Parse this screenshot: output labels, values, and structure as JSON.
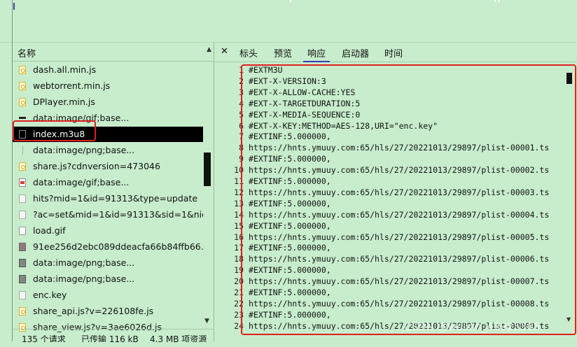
{
  "network": {
    "column_header": "名称",
    "files": [
      {
        "name": "dash.all.min.js",
        "icon": "js"
      },
      {
        "name": "webtorrent.min.js",
        "icon": "js"
      },
      {
        "name": "DPlayer.min.js",
        "icon": "js"
      },
      {
        "name": "data:image/gif;base...",
        "icon": "bar"
      },
      {
        "name": "index.m3u8",
        "icon": "plain",
        "selected": true
      },
      {
        "name": "data:image/png;base...",
        "icon": "thin"
      },
      {
        "name": "share.js?cdnversion=473046",
        "icon": "js"
      },
      {
        "name": "data:image/gif;base...",
        "icon": "gif-red"
      },
      {
        "name": "hits?mid=1&id=91313&type=update",
        "icon": "doc"
      },
      {
        "name": "?ac=set&mid=1&id=91313&sid=1&nid=",
        "icon": "doc"
      },
      {
        "name": "load.gif",
        "icon": "plain"
      },
      {
        "name": "91ee256d2ebc089ddeacfa66b84ffb66.jpg",
        "icon": "img"
      },
      {
        "name": "data:image/png;base...",
        "icon": "img-dark"
      },
      {
        "name": "data:image/png;base...",
        "icon": "img-dark"
      },
      {
        "name": "enc.key",
        "icon": "doc"
      },
      {
        "name": "share_api.js?v=226108fe.js",
        "icon": "js"
      },
      {
        "name": "share_view.js?v=3ae6026d.js",
        "icon": "js"
      }
    ],
    "status": {
      "requests": "135 个请求",
      "transferred": "已传输 116 kB",
      "resources": "4.3 MB 项资源"
    }
  },
  "detail": {
    "tabs": [
      "标头",
      "预览",
      "响应",
      "启动器",
      "时间"
    ],
    "active_tab": "响应",
    "lines": [
      "#EXTM3U",
      "#EXT-X-VERSION:3",
      "#EXT-X-ALLOW-CACHE:YES",
      "#EXT-X-TARGETDURATION:5",
      "#EXT-X-MEDIA-SEQUENCE:0",
      "#EXT-X-KEY:METHOD=AES-128,URI=\"enc.key\"",
      "#EXTINF:5.000000,",
      "https://hnts.ymuuy.com:65/hls/27/20221013/29897/plist-00001.ts",
      "#EXTINF:5.000000,",
      "https://hnts.ymuuy.com:65/hls/27/20221013/29897/plist-00002.ts",
      "#EXTINF:5.000000,",
      "https://hnts.ymuuy.com:65/hls/27/20221013/29897/plist-00003.ts",
      "#EXTINF:5.000000,",
      "https://hnts.ymuuy.com:65/hls/27/20221013/29897/plist-00004.ts",
      "#EXTINF:5.000000,",
      "https://hnts.ymuuy.com:65/hls/27/20221013/29897/plist-00005.ts",
      "#EXTINF:5.000000,",
      "https://hnts.ymuuy.com:65/hls/27/20221013/29897/plist-00006.ts",
      "#EXTINF:5.000000,",
      "https://hnts.ymuuy.com:65/hls/27/20221013/29897/plist-00007.ts",
      "#EXTINF:5.000000,",
      "https://hnts.ymuuy.com:65/hls/27/20221013/29897/plist-00008.ts",
      "#EXTINF:5.000000,",
      "https://hnts.ymuuy.com:65/hls/27/20221013/29897/plist-00009.ts"
    ]
  },
  "watermark": "CSDN @weixin_43925365",
  "colors": {
    "background": "#c7edcc",
    "highlight": "#e0201c",
    "selected_row": "#000000",
    "active_tab_underline": "#3b3bbb"
  }
}
